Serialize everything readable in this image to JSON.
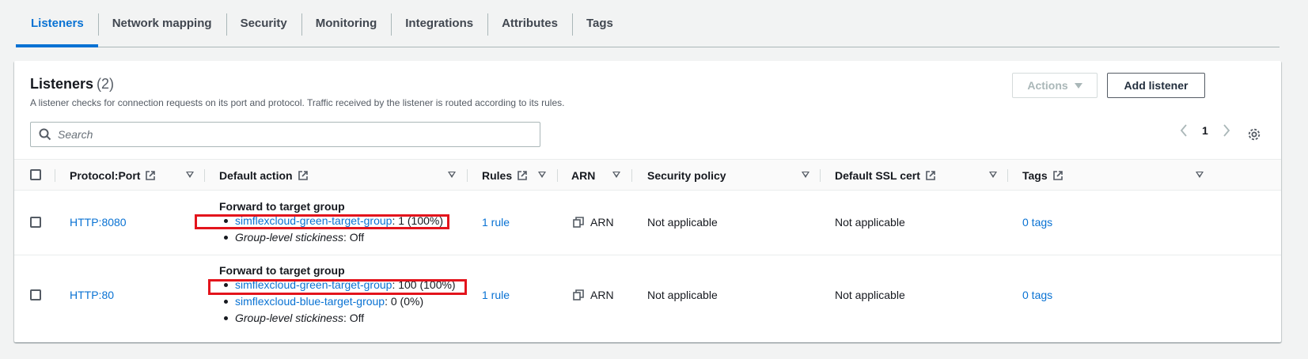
{
  "tabs": [
    {
      "label": "Listeners",
      "active": true
    },
    {
      "label": "Network mapping"
    },
    {
      "label": "Security"
    },
    {
      "label": "Monitoring"
    },
    {
      "label": "Integrations"
    },
    {
      "label": "Attributes"
    },
    {
      "label": "Tags"
    }
  ],
  "panel": {
    "title": "Listeners",
    "count": "(2)",
    "description": "A listener checks for connection requests on its port and protocol. Traffic received by the listener is routed according to its rules.",
    "actions_label": "Actions",
    "add_label": "Add listener",
    "search_placeholder": "Search",
    "page": "1"
  },
  "columns": {
    "protocol": "Protocol:Port",
    "default_action": "Default action",
    "rules": "Rules",
    "arn": "ARN",
    "security_policy": "Security policy",
    "ssl": "Default SSL cert",
    "tags": "Tags"
  },
  "rows": [
    {
      "protocol": "HTTP:8080",
      "action_title": "Forward to target group",
      "tg1_name": "simflexcloud-green-target-group",
      "tg1_weight": ": 1 (100%)",
      "stickiness_label": "Group-level stickiness",
      "stickiness_value": ": Off",
      "rules": "1 rule",
      "arn": "ARN",
      "security_policy": "Not applicable",
      "ssl": "Not applicable",
      "tags": "0 tags"
    },
    {
      "protocol": "HTTP:80",
      "action_title": "Forward to target group",
      "tg1_name": "simflexcloud-green-target-group",
      "tg1_weight": ": 100 (100%)",
      "tg2_name": "simflexcloud-blue-target-group",
      "tg2_weight": ": 0 (0%)",
      "stickiness_label": "Group-level stickiness",
      "stickiness_value": ": Off",
      "rules": "1 rule",
      "arn": "ARN",
      "security_policy": "Not applicable",
      "ssl": "Not applicable",
      "tags": "0 tags"
    }
  ],
  "colors": {
    "link": "#0972d3",
    "highlight": "#e3141c"
  },
  "icons": [
    "refresh-icon",
    "caret-down-icon",
    "search-icon",
    "chevron-left-icon",
    "chevron-right-icon",
    "settings-gear-icon",
    "external-link-icon",
    "sort-icon",
    "copy-icon"
  ]
}
